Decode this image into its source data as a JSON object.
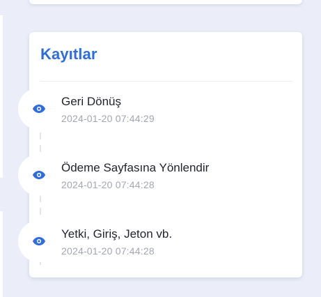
{
  "panel": {
    "title": "Kayıtlar",
    "accent_color": "#2f6ce0"
  },
  "events": [
    {
      "icon": "eye-icon",
      "title": "Geri Dönüş",
      "timestamp": "2024-01-20 07:44:29"
    },
    {
      "icon": "eye-icon",
      "title": "Ödeme Sayfasına Yönlendir",
      "timestamp": "2024-01-20 07:44:28"
    },
    {
      "icon": "eye-icon",
      "title": "Yetki, Giriş, Jeton vb.",
      "timestamp": "2024-01-20 07:44:28"
    }
  ]
}
